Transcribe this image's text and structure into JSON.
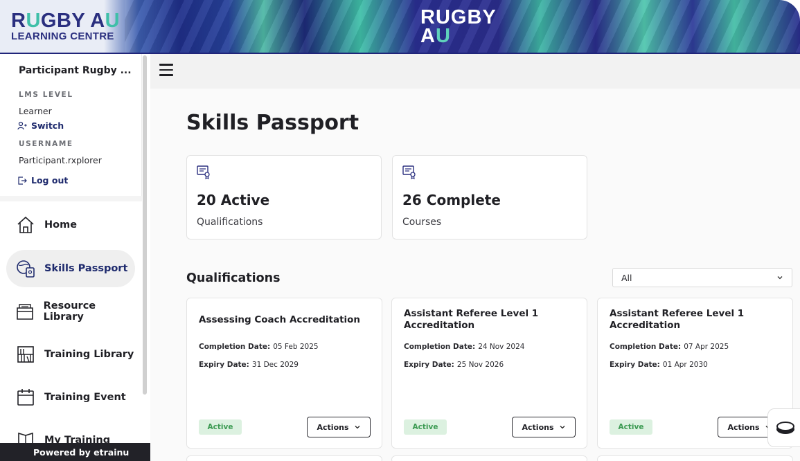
{
  "header": {
    "logo_left_line1_a": "R",
    "logo_left_line1_b": "U",
    "logo_left_line1_c": "GBY A",
    "logo_left_line1_d": "U",
    "logo_left_line2": "LEARNING CENTRE",
    "logo_center_line1": "RUGBY",
    "logo_center_line2_a": "A",
    "logo_center_line2_b": "U"
  },
  "sidebar": {
    "profile_name": "Participant Rugby ...",
    "lms_level_label": "LMS LEVEL",
    "lms_level_value": "Learner",
    "switch_label": "Switch",
    "username_label": "USERNAME",
    "username_value": "Participant.rxplorer",
    "logout_label": "Log out",
    "items": [
      {
        "label": "Home",
        "icon": "home-icon"
      },
      {
        "label": "Skills Passport",
        "icon": "passport-icon",
        "active": true
      },
      {
        "label": "Resource Library",
        "icon": "folder-icon"
      },
      {
        "label": "Training Library",
        "icon": "library-icon"
      },
      {
        "label": "Training Event",
        "icon": "calendar-icon"
      },
      {
        "label": "My Training",
        "icon": "book-icon"
      }
    ],
    "powered_by": "Powered by etrainu"
  },
  "main": {
    "title": "Skills Passport",
    "stats": [
      {
        "value": "20 Active",
        "label": "Qualifications"
      },
      {
        "value": "26 Complete",
        "label": "Courses"
      }
    ],
    "section_title": "Qualifications",
    "filter": {
      "selected": "All"
    },
    "completion_label": "Completion Date:",
    "expiry_label": "Expiry Date:",
    "actions_label": "Actions",
    "qualifications": [
      {
        "title": "Assessing Coach Accreditation",
        "completion": "05 Feb 2025",
        "expiry": "31 Dec 2029",
        "status": "Active"
      },
      {
        "title": "Assistant Referee Level 1 Accreditation",
        "completion": "24 Nov 2024",
        "expiry": "25 Nov 2026",
        "status": "Active"
      },
      {
        "title": "Assistant Referee Level 1 Accreditation",
        "completion": "07 Apr 2025",
        "expiry": "01 Apr 2030",
        "status": "Active"
      }
    ]
  },
  "colors": {
    "brand_navy": "#2a2f7f",
    "brand_teal": "#3fbfa8",
    "active_badge_bg": "#dcf1e0",
    "active_badge_text": "#3c9a52"
  }
}
